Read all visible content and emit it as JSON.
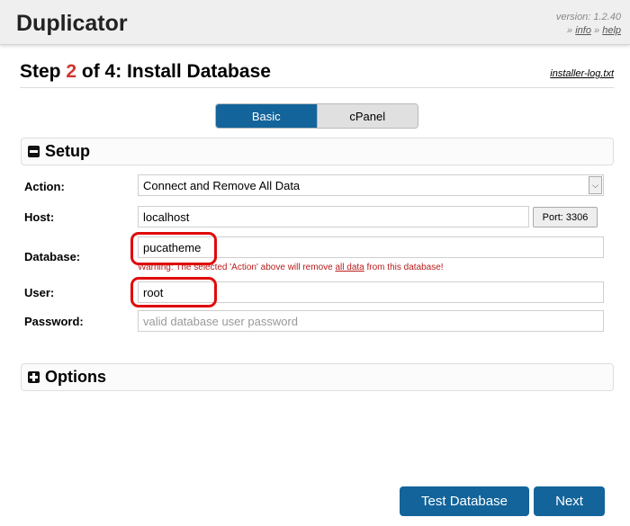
{
  "header": {
    "title": "Duplicator",
    "version": "version: 1.2.40",
    "sep1": "»",
    "info_link": "info",
    "sep2": "»",
    "help_link": "help"
  },
  "step": {
    "prefix": "Step ",
    "number": "2",
    "suffix": " of 4: Install Database",
    "log_link": "installer-log.txt"
  },
  "mode_tabs": [
    {
      "label": "Basic",
      "active": true
    },
    {
      "label": "cPanel",
      "active": false
    }
  ],
  "setup": {
    "title": "Setup",
    "action_label": "Action:",
    "action_value": "Connect and Remove All Data",
    "host_label": "Host:",
    "host_value": "localhost",
    "port_button": "Port: 3306",
    "database_label": "Database:",
    "database_value": "pucatheme",
    "warning_pre": "Warning: The selected 'Action' above will remove ",
    "warning_link": "all data",
    "warning_post": " from this database!",
    "user_label": "User:",
    "user_value": "root",
    "password_label": "Password:",
    "password_placeholder": "valid database user password"
  },
  "options": {
    "title": "Options"
  },
  "buttons": {
    "test_database": "Test Database",
    "next": "Next"
  },
  "colors": {
    "accent": "#13649a",
    "step_number": "#d0362d",
    "warning": "#b91c1c",
    "highlight_circle": "#e00b0b"
  }
}
